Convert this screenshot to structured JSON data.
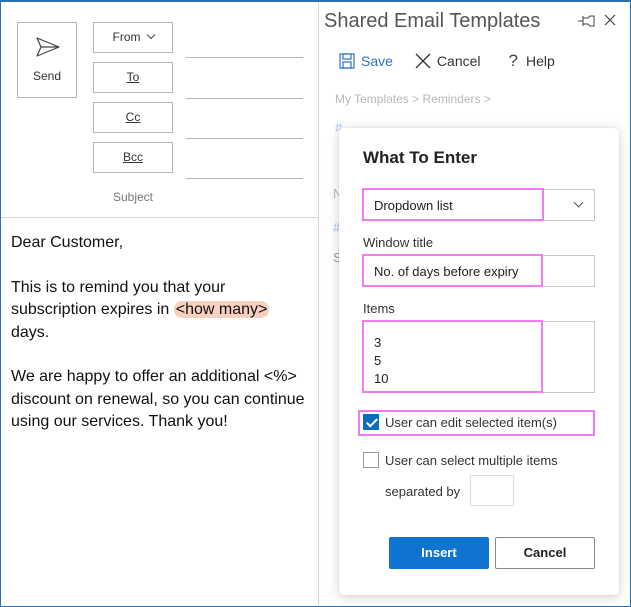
{
  "compose": {
    "send_label": "Send",
    "from_label": "From",
    "to_label": "To",
    "cc_label": "Cc",
    "bcc_label": "Bcc",
    "subject_label": "Subject",
    "body": {
      "greeting": "Dear Customer,",
      "para1_before": "This is to remind you that your subscription expires in ",
      "para1_placeholder": "<how many>",
      "para1_after": " days.",
      "para2": "We are happy to offer an additional <%> discount on renewal, so you can continue using our services. Thank you!"
    }
  },
  "pane": {
    "title": "Shared Email Templates",
    "toolbar": {
      "save": "Save",
      "cancel": "Cancel",
      "help": "Help"
    },
    "breadcrumb": "My Templates > Reminders >"
  },
  "dialog": {
    "title": "What To Enter",
    "type_select": {
      "value": "Dropdown list"
    },
    "window_title": {
      "label": "Window title",
      "value": "No. of days before expiry"
    },
    "items": {
      "label": "Items",
      "values": [
        "3",
        "5",
        "10"
      ]
    },
    "edit_selected": {
      "label": "User can edit selected item(s)",
      "checked": true
    },
    "select_multiple": {
      "label": "User can select multiple items",
      "checked": false
    },
    "separated_by": {
      "label": "separated by",
      "value": ""
    },
    "insert_label": "Insert",
    "cancel_label": "Cancel"
  },
  "colors": {
    "accent": "#0f73d1",
    "highlight_outline": "#f07cf0",
    "placeholder_bg": "#f9cfc0"
  }
}
